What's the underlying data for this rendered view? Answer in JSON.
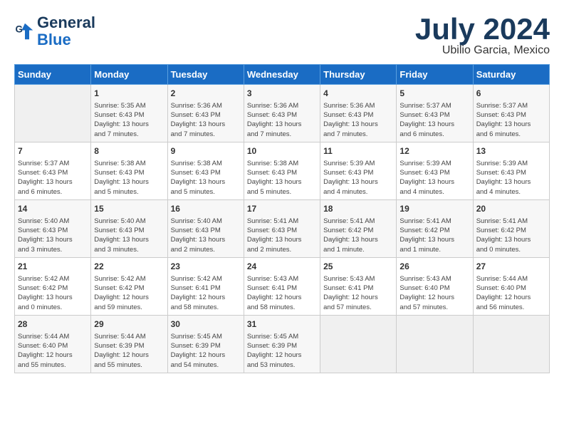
{
  "header": {
    "logo_line1": "General",
    "logo_line2": "Blue",
    "month_title": "July 2024",
    "subtitle": "Ubilio Garcia, Mexico"
  },
  "days_of_week": [
    "Sunday",
    "Monday",
    "Tuesday",
    "Wednesday",
    "Thursday",
    "Friday",
    "Saturday"
  ],
  "weeks": [
    [
      {
        "day": "",
        "info": ""
      },
      {
        "day": "1",
        "info": "Sunrise: 5:35 AM\nSunset: 6:43 PM\nDaylight: 13 hours\nand 7 minutes."
      },
      {
        "day": "2",
        "info": "Sunrise: 5:36 AM\nSunset: 6:43 PM\nDaylight: 13 hours\nand 7 minutes."
      },
      {
        "day": "3",
        "info": "Sunrise: 5:36 AM\nSunset: 6:43 PM\nDaylight: 13 hours\nand 7 minutes."
      },
      {
        "day": "4",
        "info": "Sunrise: 5:36 AM\nSunset: 6:43 PM\nDaylight: 13 hours\nand 7 minutes."
      },
      {
        "day": "5",
        "info": "Sunrise: 5:37 AM\nSunset: 6:43 PM\nDaylight: 13 hours\nand 6 minutes."
      },
      {
        "day": "6",
        "info": "Sunrise: 5:37 AM\nSunset: 6:43 PM\nDaylight: 13 hours\nand 6 minutes."
      }
    ],
    [
      {
        "day": "7",
        "info": "Sunrise: 5:37 AM\nSunset: 6:43 PM\nDaylight: 13 hours\nand 6 minutes."
      },
      {
        "day": "8",
        "info": "Sunrise: 5:38 AM\nSunset: 6:43 PM\nDaylight: 13 hours\nand 5 minutes."
      },
      {
        "day": "9",
        "info": "Sunrise: 5:38 AM\nSunset: 6:43 PM\nDaylight: 13 hours\nand 5 minutes."
      },
      {
        "day": "10",
        "info": "Sunrise: 5:38 AM\nSunset: 6:43 PM\nDaylight: 13 hours\nand 5 minutes."
      },
      {
        "day": "11",
        "info": "Sunrise: 5:39 AM\nSunset: 6:43 PM\nDaylight: 13 hours\nand 4 minutes."
      },
      {
        "day": "12",
        "info": "Sunrise: 5:39 AM\nSunset: 6:43 PM\nDaylight: 13 hours\nand 4 minutes."
      },
      {
        "day": "13",
        "info": "Sunrise: 5:39 AM\nSunset: 6:43 PM\nDaylight: 13 hours\nand 4 minutes."
      }
    ],
    [
      {
        "day": "14",
        "info": "Sunrise: 5:40 AM\nSunset: 6:43 PM\nDaylight: 13 hours\nand 3 minutes."
      },
      {
        "day": "15",
        "info": "Sunrise: 5:40 AM\nSunset: 6:43 PM\nDaylight: 13 hours\nand 3 minutes."
      },
      {
        "day": "16",
        "info": "Sunrise: 5:40 AM\nSunset: 6:43 PM\nDaylight: 13 hours\nand 2 minutes."
      },
      {
        "day": "17",
        "info": "Sunrise: 5:41 AM\nSunset: 6:43 PM\nDaylight: 13 hours\nand 2 minutes."
      },
      {
        "day": "18",
        "info": "Sunrise: 5:41 AM\nSunset: 6:42 PM\nDaylight: 13 hours\nand 1 minute."
      },
      {
        "day": "19",
        "info": "Sunrise: 5:41 AM\nSunset: 6:42 PM\nDaylight: 13 hours\nand 1 minute."
      },
      {
        "day": "20",
        "info": "Sunrise: 5:41 AM\nSunset: 6:42 PM\nDaylight: 13 hours\nand 0 minutes."
      }
    ],
    [
      {
        "day": "21",
        "info": "Sunrise: 5:42 AM\nSunset: 6:42 PM\nDaylight: 13 hours\nand 0 minutes."
      },
      {
        "day": "22",
        "info": "Sunrise: 5:42 AM\nSunset: 6:42 PM\nDaylight: 12 hours\nand 59 minutes."
      },
      {
        "day": "23",
        "info": "Sunrise: 5:42 AM\nSunset: 6:41 PM\nDaylight: 12 hours\nand 58 minutes."
      },
      {
        "day": "24",
        "info": "Sunrise: 5:43 AM\nSunset: 6:41 PM\nDaylight: 12 hours\nand 58 minutes."
      },
      {
        "day": "25",
        "info": "Sunrise: 5:43 AM\nSunset: 6:41 PM\nDaylight: 12 hours\nand 57 minutes."
      },
      {
        "day": "26",
        "info": "Sunrise: 5:43 AM\nSunset: 6:40 PM\nDaylight: 12 hours\nand 57 minutes."
      },
      {
        "day": "27",
        "info": "Sunrise: 5:44 AM\nSunset: 6:40 PM\nDaylight: 12 hours\nand 56 minutes."
      }
    ],
    [
      {
        "day": "28",
        "info": "Sunrise: 5:44 AM\nSunset: 6:40 PM\nDaylight: 12 hours\nand 55 minutes."
      },
      {
        "day": "29",
        "info": "Sunrise: 5:44 AM\nSunset: 6:39 PM\nDaylight: 12 hours\nand 55 minutes."
      },
      {
        "day": "30",
        "info": "Sunrise: 5:45 AM\nSunset: 6:39 PM\nDaylight: 12 hours\nand 54 minutes."
      },
      {
        "day": "31",
        "info": "Sunrise: 5:45 AM\nSunset: 6:39 PM\nDaylight: 12 hours\nand 53 minutes."
      },
      {
        "day": "",
        "info": ""
      },
      {
        "day": "",
        "info": ""
      },
      {
        "day": "",
        "info": ""
      }
    ]
  ]
}
